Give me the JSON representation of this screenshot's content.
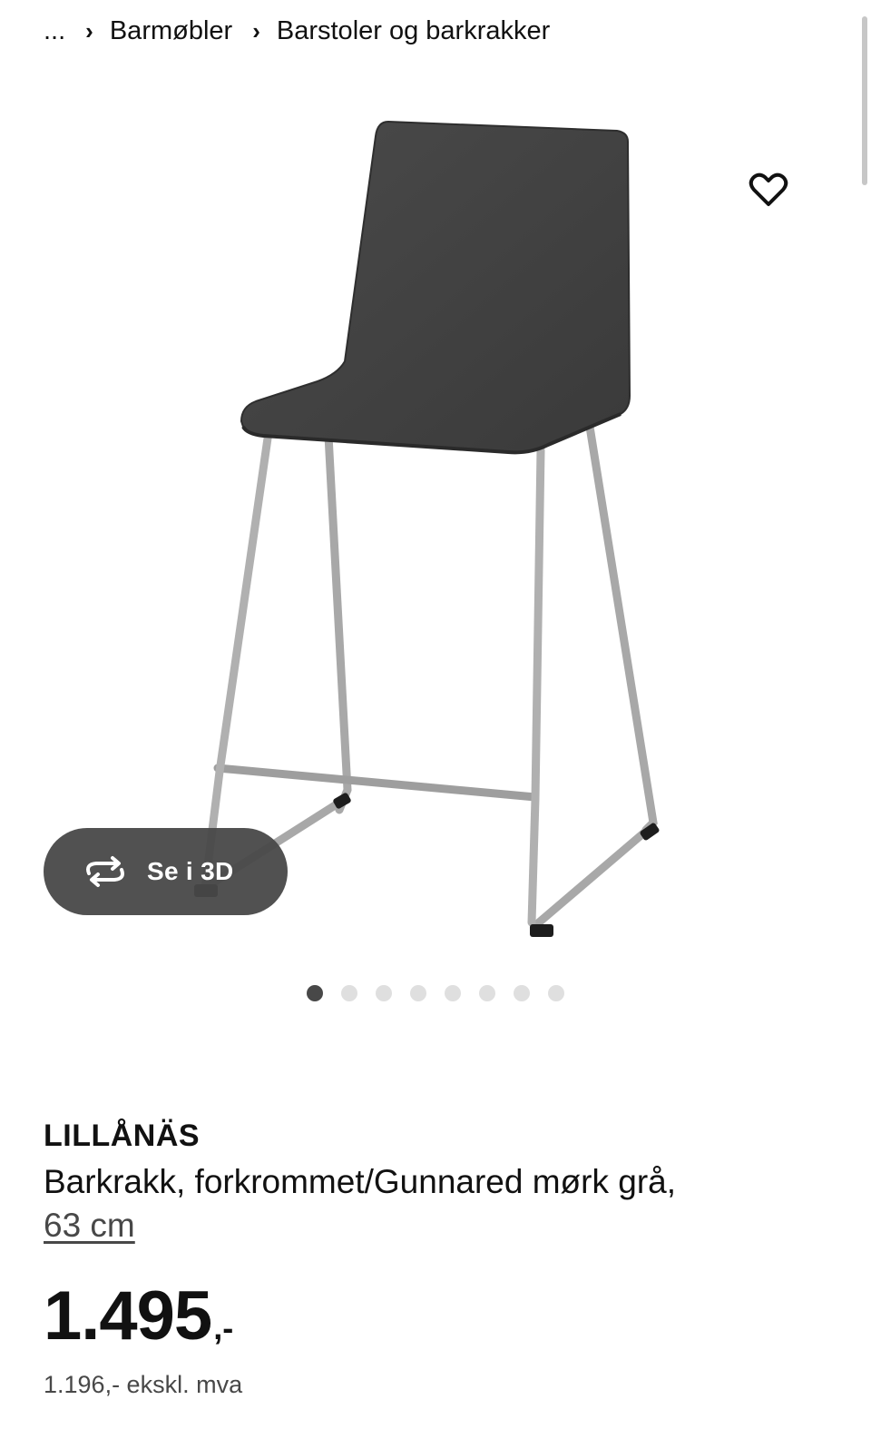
{
  "breadcrumb": {
    "ellipsis": "...",
    "separator": "›",
    "items": [
      "Barmøbler",
      "Barstoler og barkrakker"
    ]
  },
  "product": {
    "image_alt": "LILLÅNÄS barkrakk",
    "name": "LILLÅNÄS",
    "description": "Barkrakk, forkrommet/Gunnared mørk grå,",
    "size_link": "63 cm",
    "price_main": "1.495",
    "price_suffix": ",-",
    "price_exvat": "1.196,- ekskl. mva"
  },
  "gallery": {
    "view3d_label": "Se i 3D",
    "dot_count": 8,
    "active_dot": 1
  },
  "icons": {
    "favorite": "heart-icon",
    "view3d": "rotate-3d-icon"
  },
  "colors": {
    "text": "#111111",
    "muted": "#484848",
    "button_bg": "#484848",
    "dot_inactive": "#dfdfdf"
  }
}
